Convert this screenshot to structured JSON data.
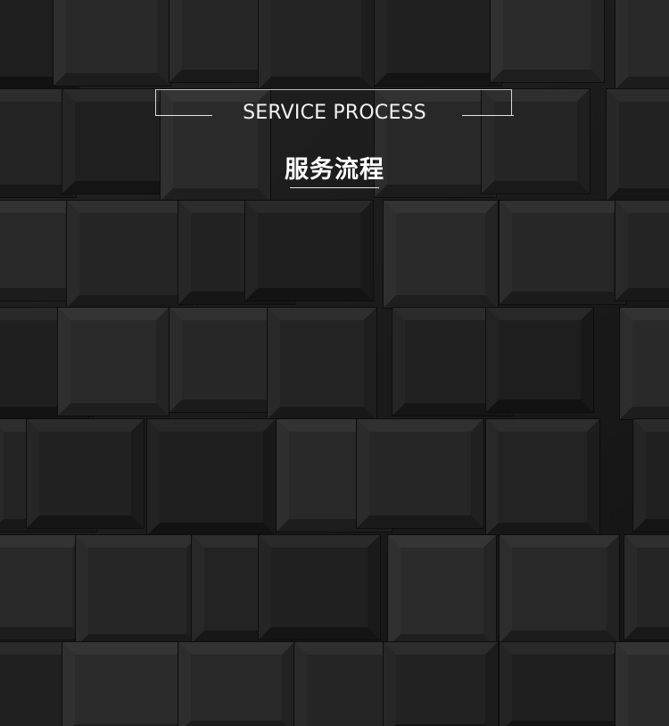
{
  "section": {
    "title_en": "SERVICE PROCESS",
    "title_zh": "服务流程"
  },
  "colors": {
    "background": "#161616",
    "text": "#f2f2f2",
    "line": "#e0e0e0"
  }
}
